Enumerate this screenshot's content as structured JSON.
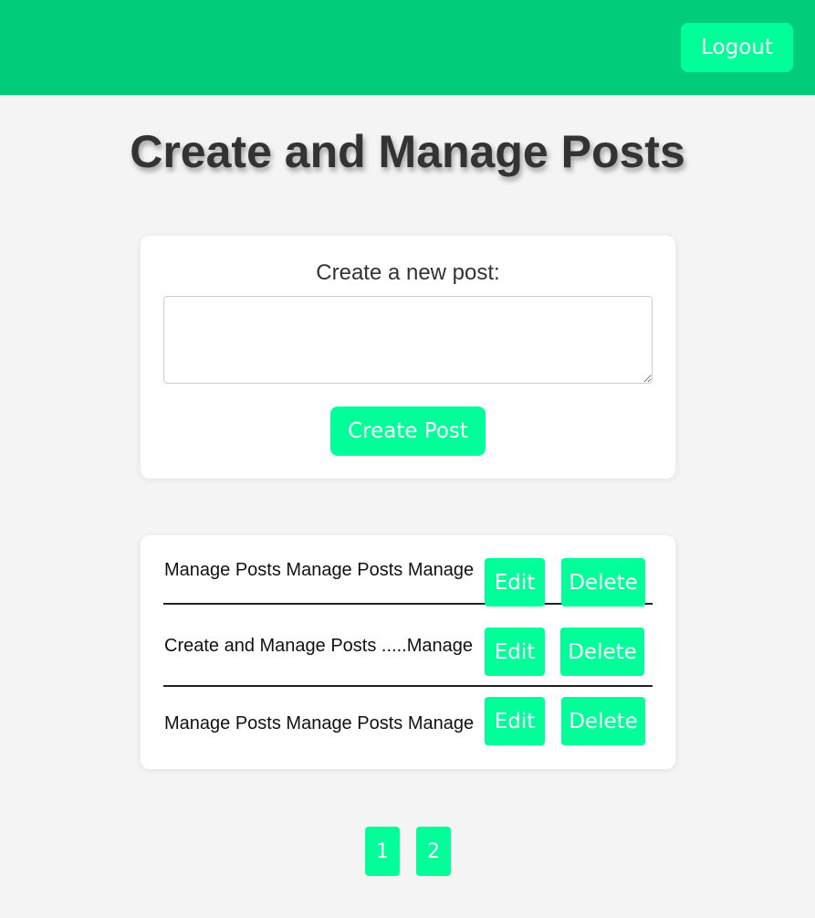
{
  "header": {
    "logout_label": "Logout",
    "background_color": "#00cc7a",
    "button_color": "#00ff99"
  },
  "main": {
    "title": "Create and Manage Posts"
  },
  "create_post": {
    "label": "Create a new post:",
    "textarea_value": "",
    "button_label": "Create Post"
  },
  "posts": {
    "items": [
      {
        "text": "Manage Posts Manage Posts Manage",
        "edit_label": "Edit",
        "delete_label": "Delete"
      },
      {
        "text": "Create and Manage Posts .....Manage",
        "edit_label": "Edit",
        "delete_label": "Delete"
      },
      {
        "text": "Manage Posts Manage Posts Manage",
        "edit_label": "Edit",
        "delete_label": "Delete"
      }
    ]
  },
  "pagination": {
    "pages": [
      "1",
      "2"
    ]
  }
}
